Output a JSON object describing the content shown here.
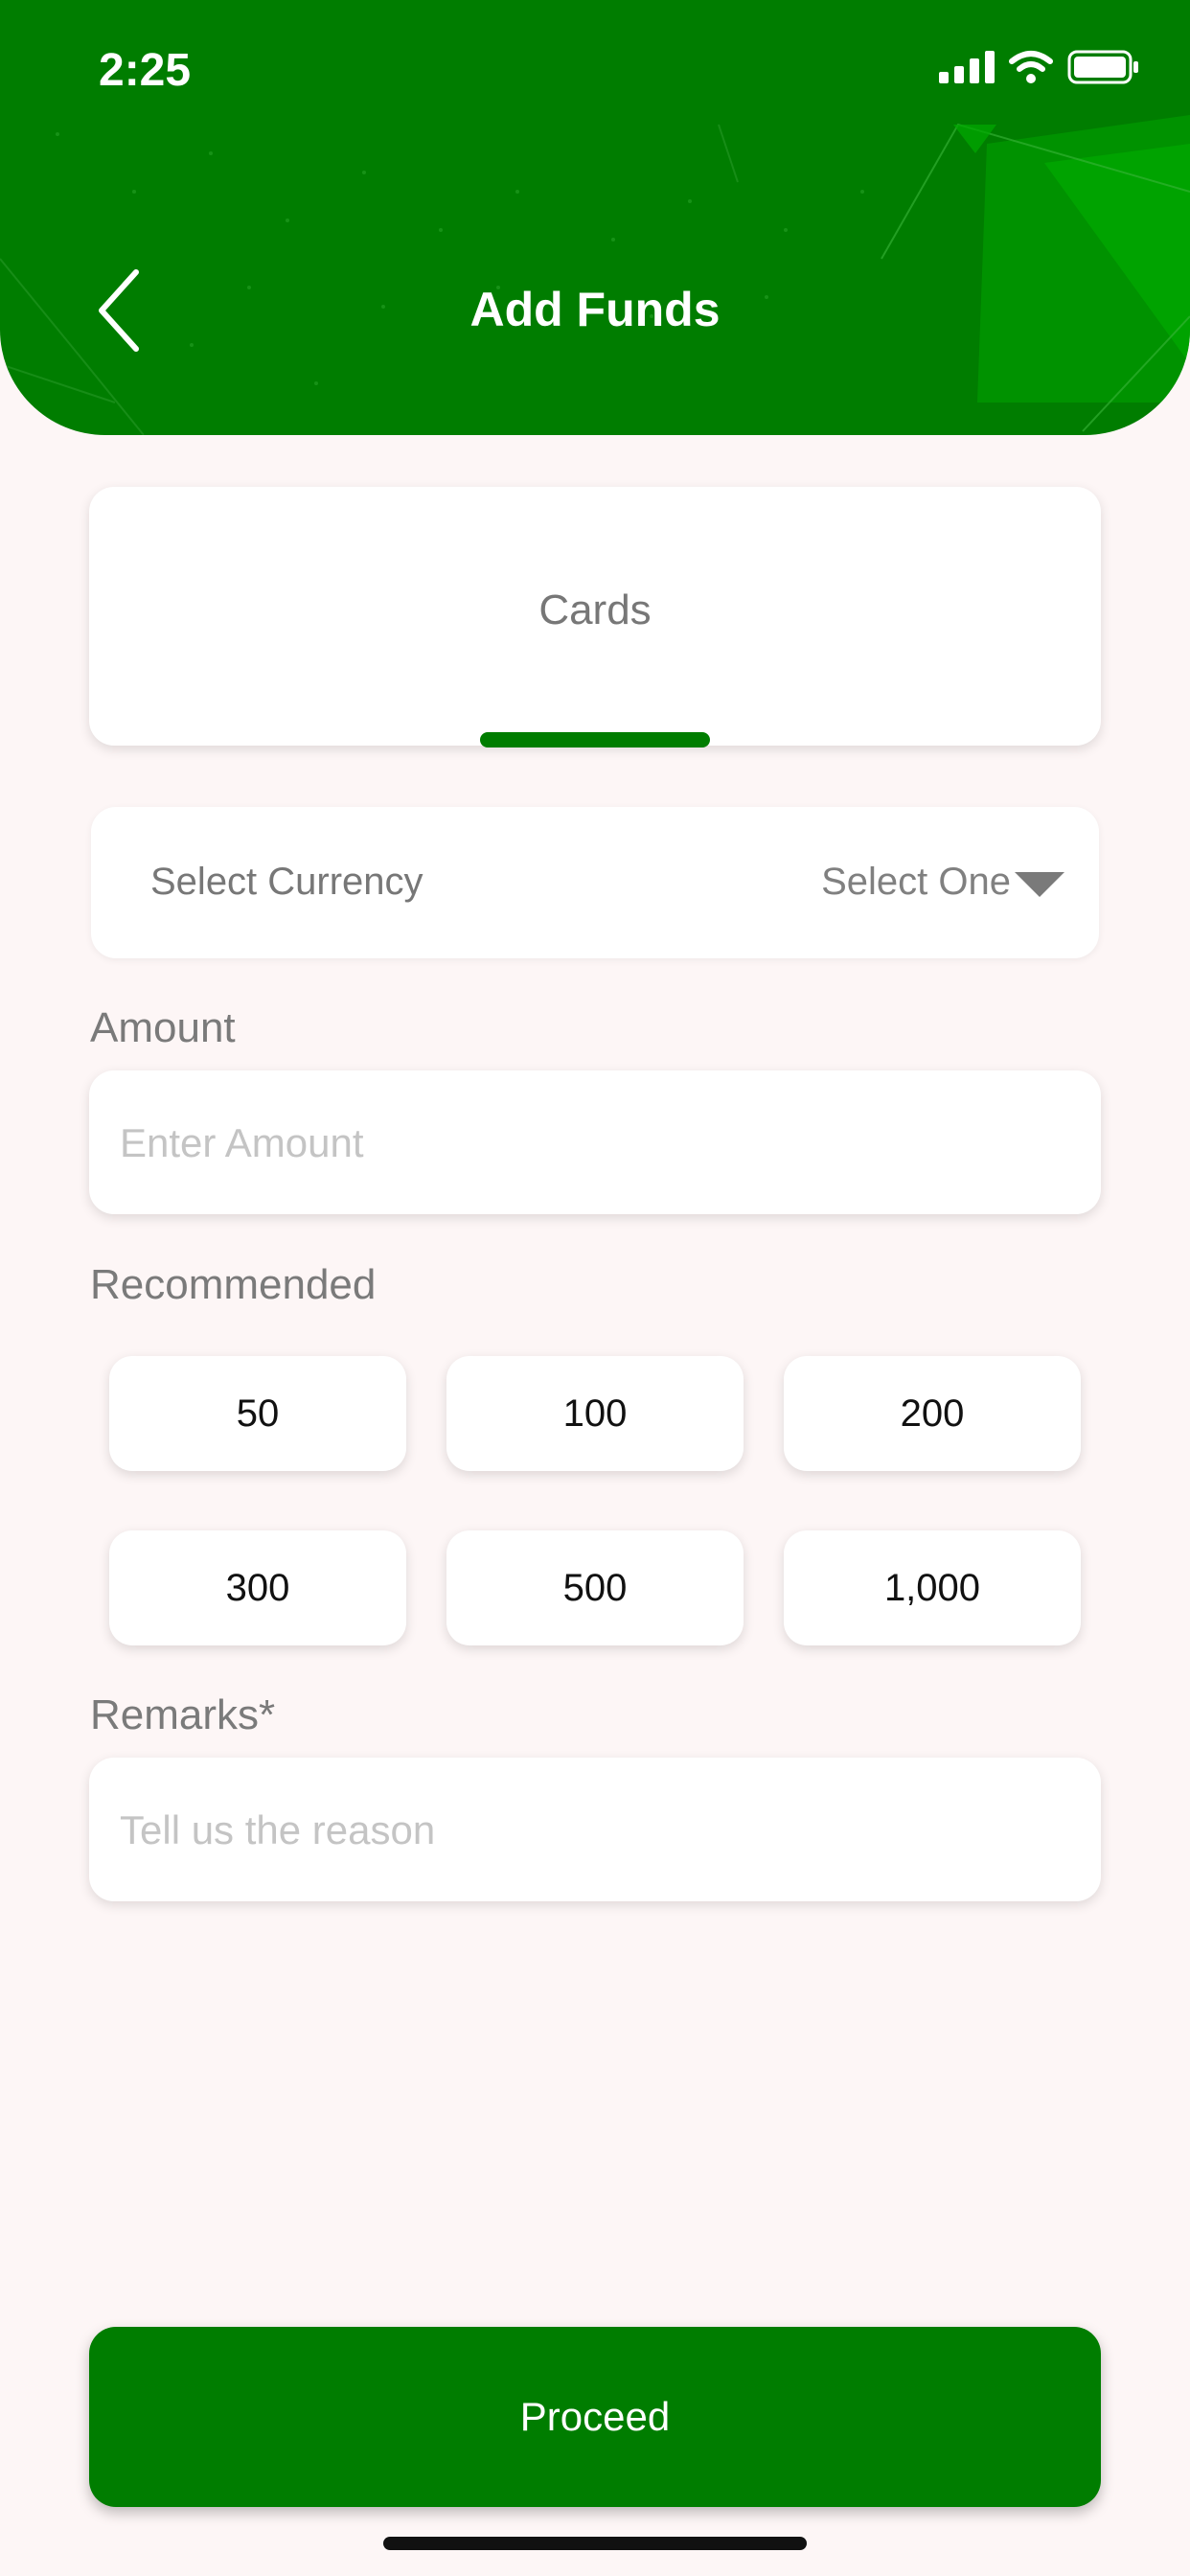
{
  "status_bar": {
    "time": "2:25"
  },
  "header": {
    "title": "Add Funds"
  },
  "tabs": {
    "active_label": "Cards"
  },
  "currency": {
    "label": "Select Currency",
    "value": "Select One"
  },
  "amount": {
    "label": "Amount",
    "placeholder": "Enter Amount"
  },
  "recommended": {
    "label": "Recommended",
    "options": [
      "50",
      "100",
      "200",
      "300",
      "500",
      "1,000"
    ]
  },
  "remarks": {
    "label": "Remarks*",
    "placeholder": "Tell us the reason"
  },
  "actions": {
    "proceed_label": "Proceed"
  },
  "colors": {
    "brand_green": "#007D00",
    "background": "#FDF6F6"
  }
}
